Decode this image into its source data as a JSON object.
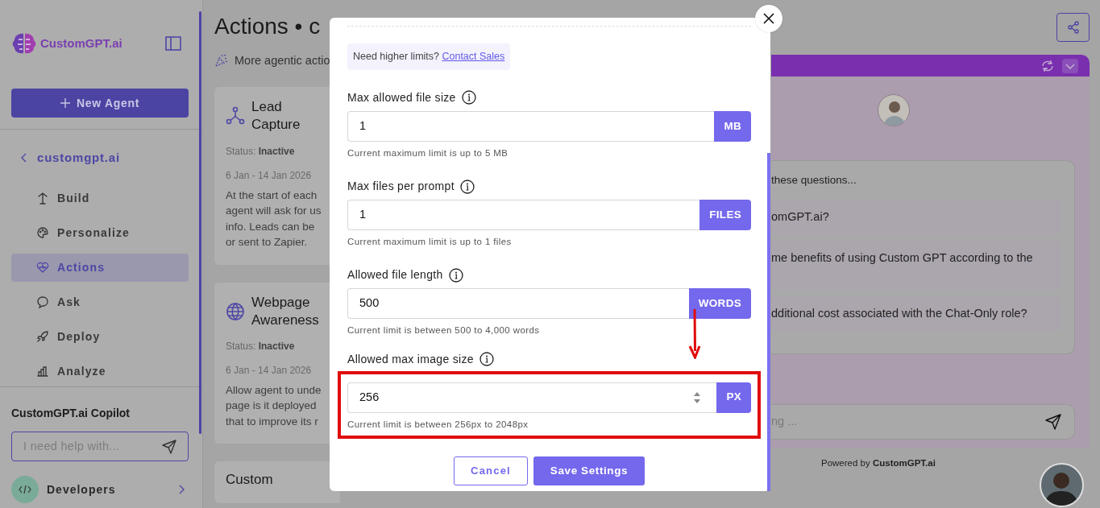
{
  "sidebar": {
    "brand": "CustomGPT.ai",
    "new_agent_button": "New Agent",
    "back_link": "customgpt.ai",
    "nav_items": [
      {
        "label": "Build",
        "selected": false
      },
      {
        "label": "Personalize",
        "selected": false
      },
      {
        "label": "Actions",
        "selected": true
      },
      {
        "label": "Ask",
        "selected": false
      },
      {
        "label": "Deploy",
        "selected": false
      },
      {
        "label": "Analyze",
        "selected": false
      }
    ],
    "copilot": {
      "title": "CustomGPT.ai Copilot",
      "placeholder": "I need help with..."
    },
    "developers": "Developers"
  },
  "page": {
    "title": "Actions • c",
    "banner": "More agentic actio",
    "cards": [
      {
        "title": "Lead Capture",
        "status_label": "Status:",
        "status": "Inactive",
        "dates": "6 Jan - 14 Jan 2026",
        "description_lines": [
          "At the start of each",
          "agent will ask for us",
          "info. Leads can be",
          "or sent to Zapier."
        ]
      },
      {
        "title": "Webpage Awareness",
        "status_label": "Status:",
        "status": "Inactive",
        "dates": "6 Jan - 14 Jan 2026",
        "description_lines": [
          "Allow agent to unde",
          "page is it deployed",
          "that to improve its r"
        ]
      },
      {
        "title": "Custom"
      }
    ]
  },
  "modal": {
    "note": {
      "text": "Need higher limits?",
      "link": "Contact Sales"
    },
    "fields": [
      {
        "label": "Max allowed file size",
        "value": "1",
        "unit": "MB",
        "help": "Current maximum limit is up to 5 MB",
        "stepper": false,
        "highlighted": false
      },
      {
        "label": "Max files per prompt",
        "value": "1",
        "unit": "FILES",
        "help": "Current maximum limit is up to 1 files",
        "stepper": false,
        "highlighted": false
      },
      {
        "label": "Allowed file length",
        "value": "500",
        "unit": "WORDS",
        "help": "Current limit is between 500 to 4,000 words",
        "stepper": false,
        "highlighted": false
      },
      {
        "label": "Allowed max image size",
        "value": "256",
        "unit": "PX",
        "help": "Current limit is between 256px to 2048px",
        "stepper": true,
        "highlighted": true
      }
    ],
    "buttons": {
      "cancel": "Cancel",
      "save": "Save Settings"
    }
  },
  "chat": {
    "suggestions_heading": "these questions...",
    "suggestions": [
      "omGPT.ai?",
      "me benefits of using Custom GPT according to the",
      "dditional cost associated with the Chat-Only role?"
    ],
    "input_placeholder": "ng ...",
    "powered_by": "Powered by **CustomGPT.ai**"
  }
}
